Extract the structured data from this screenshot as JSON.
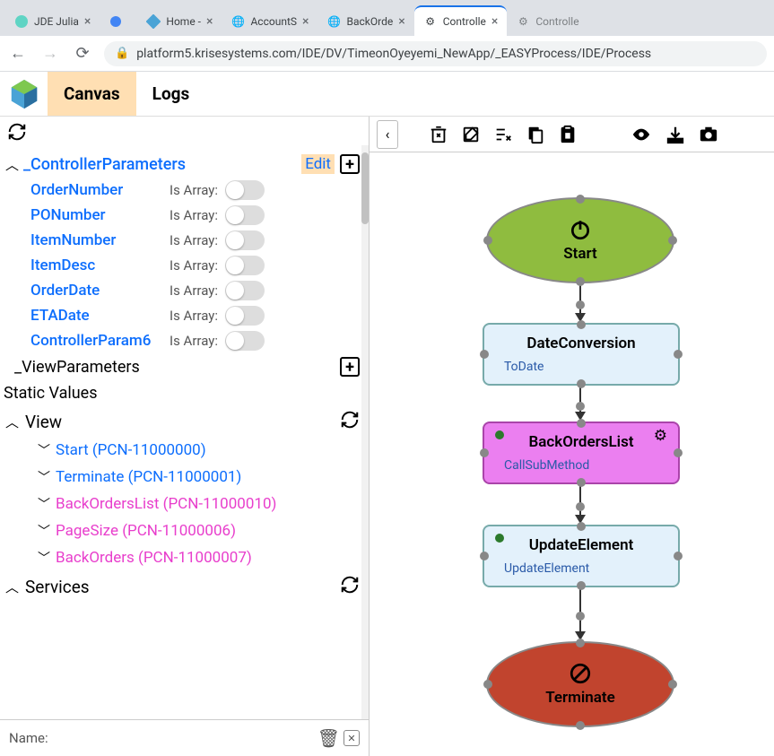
{
  "browser": {
    "tabs": [
      {
        "title": "JDE Julia"
      },
      {
        "title": ""
      },
      {
        "title": "Home - "
      },
      {
        "title": "AccountS"
      },
      {
        "title": "BackOrde"
      },
      {
        "title": "Controlle"
      },
      {
        "title": "Controlle"
      }
    ],
    "url": "platform5.krisesystems.com/IDE/DV/TimeonOyeyemi_NewApp/_EASYProcess/IDE/Process"
  },
  "appTabs": {
    "canvas": "Canvas",
    "logs": "Logs"
  },
  "sections": {
    "controllerParams": {
      "title": "_ControllerParameters",
      "edit": "Edit"
    },
    "viewParams": "_ViewParameters",
    "staticValues": "Static Values",
    "view": "View",
    "services": "Services"
  },
  "isArrayLabel": "Is Array:",
  "params": [
    {
      "name": "OrderNumber"
    },
    {
      "name": "PONumber"
    },
    {
      "name": "ItemNumber"
    },
    {
      "name": "ItemDesc"
    },
    {
      "name": "OrderDate"
    },
    {
      "name": "ETADate"
    },
    {
      "name": "ControllerParam6"
    }
  ],
  "viewItems": [
    {
      "label": "Start (PCN-11000000)",
      "cls": "blue-link"
    },
    {
      "label": "Terminate (PCN-11000001)",
      "cls": "blue-link"
    },
    {
      "label": "BackOrdersList (PCN-11000010)",
      "cls": "pink-link"
    },
    {
      "label": "PageSize (PCN-11000006)",
      "cls": "pink-link"
    },
    {
      "label": "BackOrders (PCN-11000007)",
      "cls": "pink-link"
    }
  ],
  "nameLabel": "Name:",
  "nodes": {
    "start": {
      "title": "Start"
    },
    "date": {
      "title": "DateConversion",
      "sub": "ToDate"
    },
    "back": {
      "title": "BackOrdersList",
      "sub": "CallSubMethod"
    },
    "update": {
      "title": "UpdateElement",
      "sub": "UpdateElement"
    },
    "term": {
      "title": "Terminate"
    }
  }
}
